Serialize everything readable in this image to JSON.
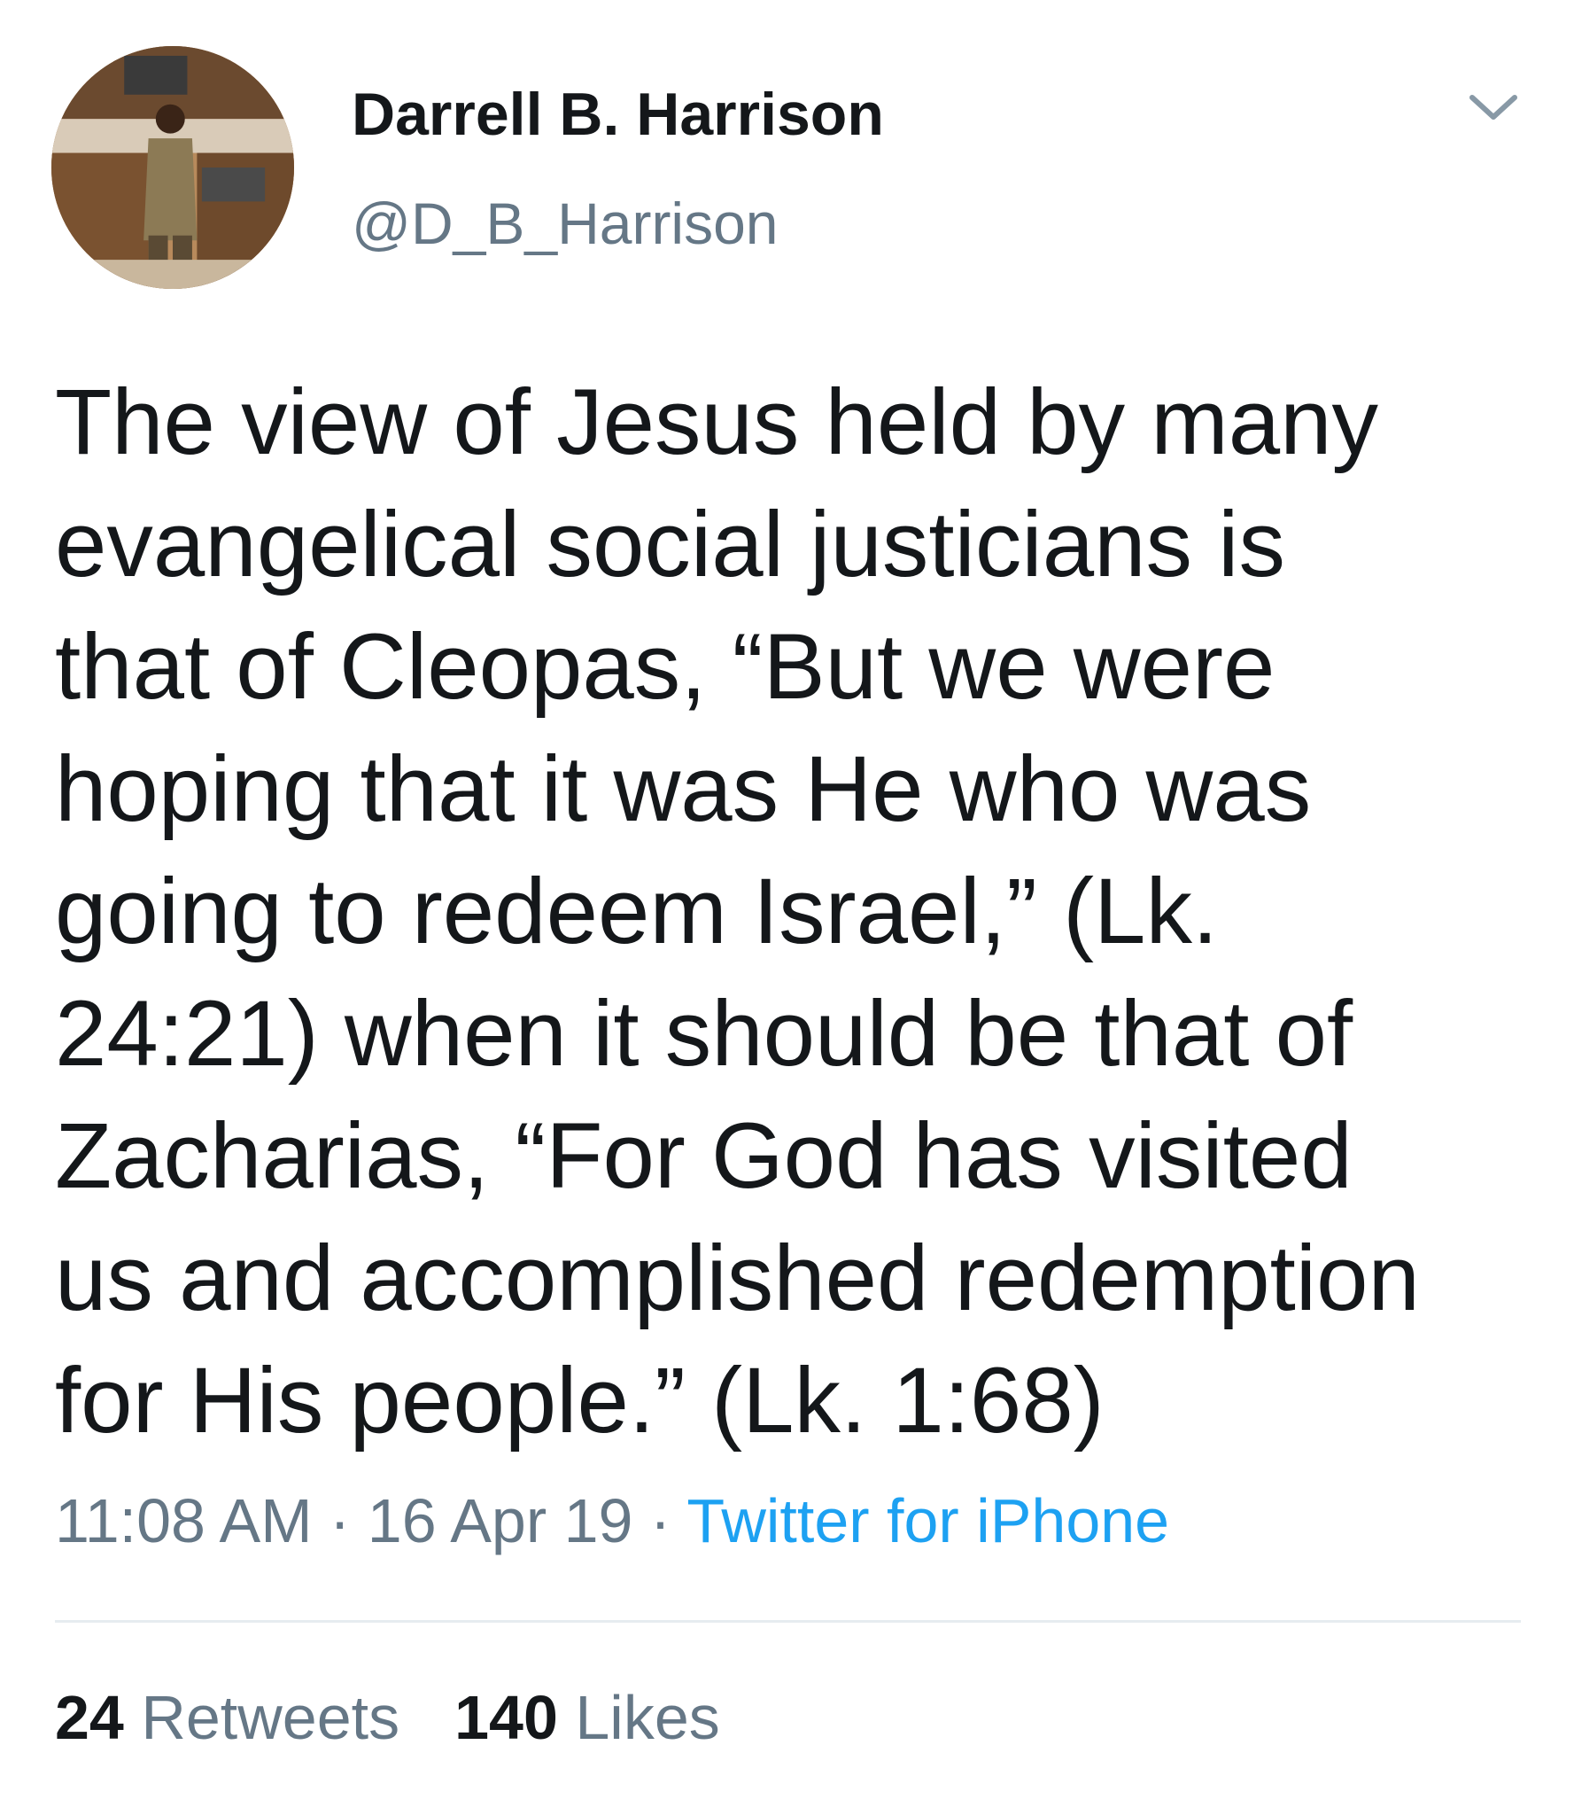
{
  "author": {
    "name": "Darrell B. Harrison",
    "handle": "@D_B_Harrison"
  },
  "tweet": {
    "lines": [
      "The view of Jesus held by many",
      "evangelical social justicians is",
      "that of Cleopas, “But we were",
      "hoping that it was He who was",
      "going to redeem Israel,” (Lk.",
      "24:21) when it should be that of",
      "Zacharias, “For God has visited",
      "us and accomplished redemption",
      "for His people.” (Lk. 1:68)"
    ]
  },
  "meta": {
    "time": "11:08 AM",
    "separator": " · ",
    "date": "16 Apr 19",
    "source": "Twitter for iPhone"
  },
  "stats": {
    "retweets_count": "24",
    "retweets_label": "Retweets",
    "likes_count": "140",
    "likes_label": "Likes"
  },
  "colors": {
    "text": "#14171a",
    "secondary": "#657786",
    "link": "#1da1f2",
    "divider": "#e6ecf0"
  },
  "icons": {
    "menu": "chevron-down-icon",
    "avatar": "profile-photo"
  }
}
